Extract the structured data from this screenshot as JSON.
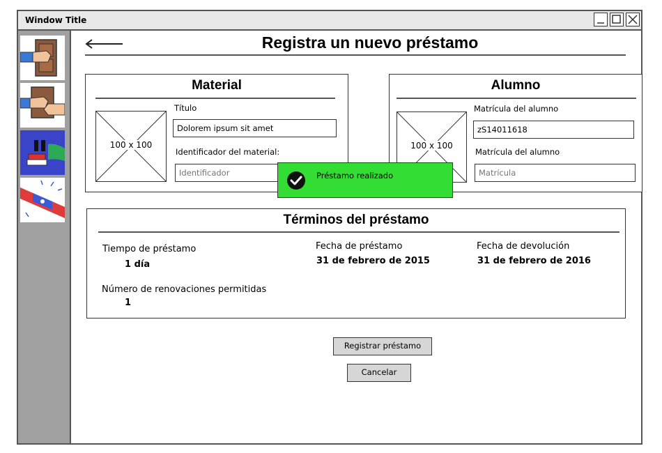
{
  "window": {
    "title": "Window Title"
  },
  "sidebar": {
    "items": [
      {
        "icon": "door-knock-icon"
      },
      {
        "icon": "handshake-book-icon"
      },
      {
        "icon": "paused-book-icon"
      },
      {
        "icon": "siren-alert-icon"
      }
    ]
  },
  "page": {
    "title": "Registra un nuevo préstamo"
  },
  "material": {
    "title": "Material",
    "image_label": "100 x 100",
    "titulo_label": "Título",
    "titulo_value": "Dolorem ipsum sit amet",
    "id_label": "Identificador del material:",
    "id_placeholder": "Identificador"
  },
  "alumno": {
    "title": "Alumno",
    "image_label": "100 x 100",
    "matricula_label_1": "Matrícula del alumno",
    "matricula_value": "zS14011618",
    "matricula_label_2": "Matrícula del alumno",
    "matricula_placeholder": "Matrícula"
  },
  "terms": {
    "title": "Términos del préstamo",
    "tiempo_label": "Tiempo de préstamo",
    "tiempo_value": "1 día",
    "fecha_prestamo_label": "Fecha de préstamo",
    "fecha_prestamo_value": "31 de febrero de 2015",
    "fecha_devolucion_label": "Fecha de devolución",
    "fecha_devolucion_value": "31 de febrero de 2016",
    "renovaciones_label": "Número de renovaciones permitidas",
    "renovaciones_value": "1"
  },
  "actions": {
    "register_label": "Registrar préstamo",
    "cancel_label": "Cancelar"
  },
  "toast": {
    "message": "Préstamo realizado",
    "icon": "check-circle-icon",
    "color": "#33dd33"
  }
}
